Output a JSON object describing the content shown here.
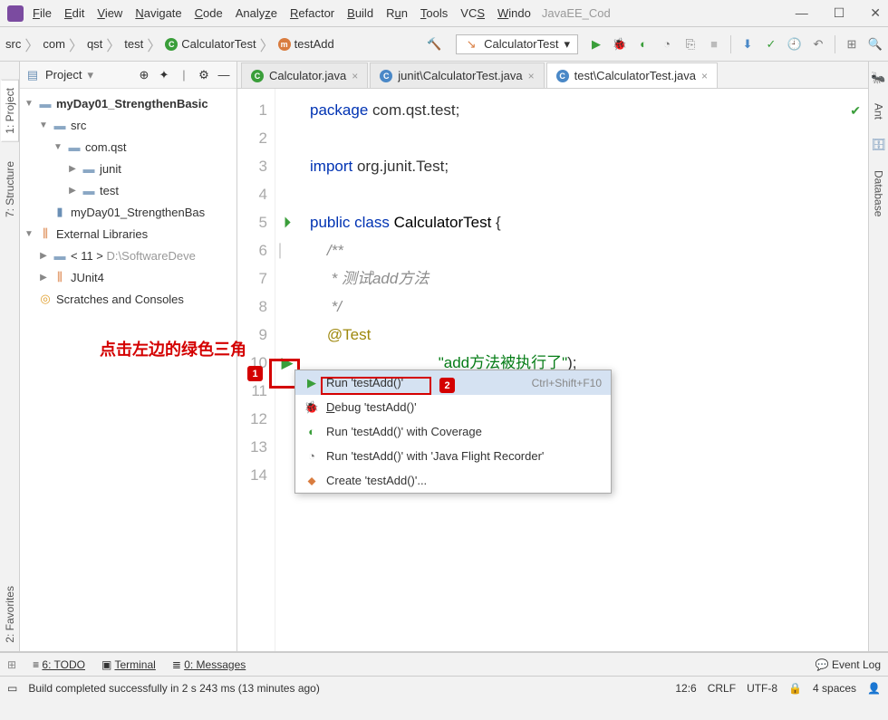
{
  "window": {
    "title": "JavaEE_Cod"
  },
  "menu": [
    "File",
    "Edit",
    "View",
    "Navigate",
    "Code",
    "Analyze",
    "Refactor",
    "Build",
    "Run",
    "Tools",
    "VCS",
    "Window"
  ],
  "breadcrumb": [
    "src",
    "com",
    "qst",
    "test",
    "CalculatorTest",
    "testAdd"
  ],
  "run_config": "CalculatorTest",
  "project_panel": {
    "title": "Project"
  },
  "tree": {
    "root": "myDay01_StrengthenBasic",
    "src": "src",
    "pkg": "com.qst",
    "junit": "junit",
    "test": "test",
    "iml": "myDay01_StrengthenBas",
    "ext": "External Libraries",
    "jdk": "< 11 >",
    "jdk_path": "D:\\SoftwareDeve",
    "junit4": "JUnit4",
    "scratch": "Scratches and Consoles"
  },
  "tabs": [
    {
      "label": "Calculator.java",
      "active": false,
      "cls": "green"
    },
    {
      "label": "junit\\CalculatorTest.java",
      "active": false,
      "cls": "blue"
    },
    {
      "label": "test\\CalculatorTest.java",
      "active": true,
      "cls": "blue"
    }
  ],
  "code": {
    "l1a": "package",
    "l1b": " com.qst.test;",
    "l3a": "import",
    "l3b": " org.junit.Test;",
    "l5a": "public class ",
    "l5b": "CalculatorTest",
    " l5c": " {",
    "l6": "/**",
    "l7": " * 测试add方法",
    "l8": " */",
    "l9": "@Test",
    "l10_after": "(\"add方法被执行了\");"
  },
  "context_menu": {
    "run": "Run 'testAdd()'",
    "run_shortcut": "Ctrl+Shift+F10",
    "debug": "Debug 'testAdd()'",
    "coverage": "Run 'testAdd()' with Coverage",
    "jfr": "Run 'testAdd()' with 'Java Flight Recorder'",
    "create": "Create 'testAdd()'..."
  },
  "annotation": "点击左边的绿色三角",
  "bottom_tabs": {
    "todo": "6: TODO",
    "terminal": "Terminal",
    "messages": "0: Messages",
    "event_log": "Event Log"
  },
  "status": {
    "msg": "Build completed successfully in 2 s 243 ms (13 minutes ago)",
    "pos": "12:6",
    "crlf": "CRLF",
    "enc": "UTF-8",
    "indent": "4 spaces"
  },
  "right_tabs": {
    "ant": "Ant",
    "db": "Database"
  },
  "left_tabs": {
    "project": "1: Project",
    "structure": "7: Structure",
    "favorites": "2: Favorites"
  }
}
